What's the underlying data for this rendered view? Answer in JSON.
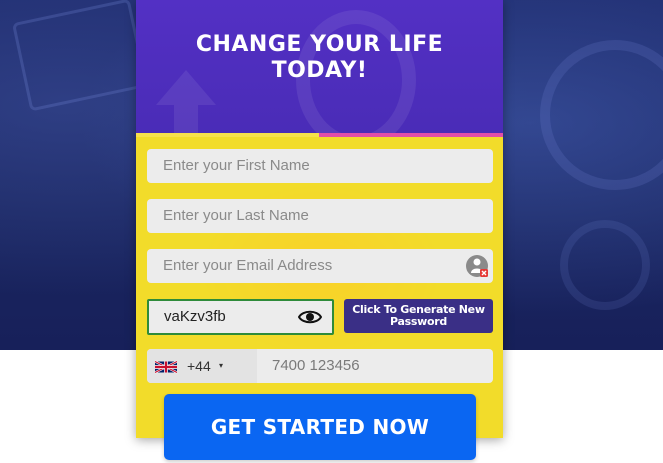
{
  "header": {
    "headline_line1": "CHANGE YOUR LIFE",
    "headline_line2": "TODAY!"
  },
  "form": {
    "first_name": {
      "placeholder": "Enter your First Name",
      "value": ""
    },
    "last_name": {
      "placeholder": "Enter your Last Name",
      "value": ""
    },
    "email": {
      "placeholder": "Enter your Email Address",
      "value": ""
    },
    "password": {
      "value": "vaKzv3fb",
      "visibility_icon": "eye-icon"
    },
    "generate_button_line1": "Click To Generate New",
    "generate_button_line2": "Password",
    "phone": {
      "country_flag": "uk-flag",
      "dial_code": "+44",
      "caret": "▾",
      "placeholder": "7400 123456"
    },
    "submit_label": "GET STARTED NOW"
  },
  "colors": {
    "form_background": "#f2dc2a",
    "header_background": "#4a2cb7",
    "submit_button": "#0a66f2",
    "generate_button": "#3a2f86",
    "password_border": "#2e8b3a",
    "page_background": "#1d2a6b"
  }
}
